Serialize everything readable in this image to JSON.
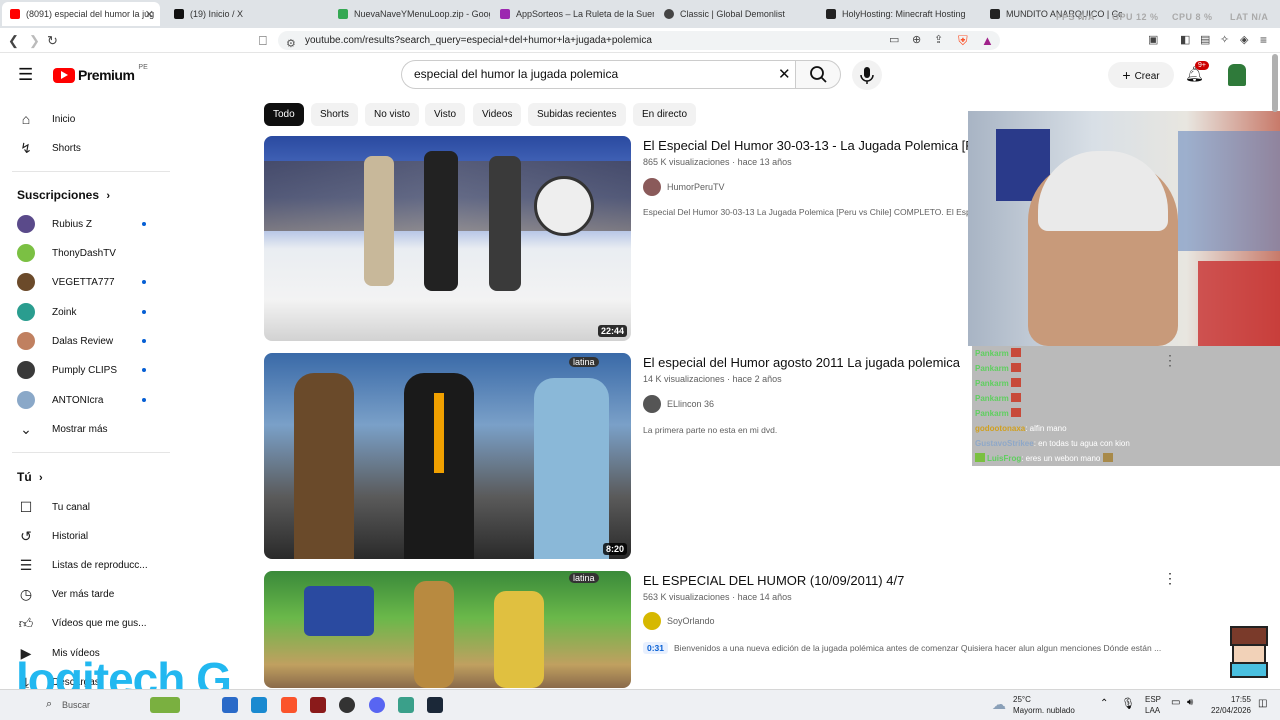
{
  "browser": {
    "tabs": [
      {
        "label": "(8091) especial del humor la jug",
        "fav": "#ff0000",
        "active": true
      },
      {
        "label": "(19) Inicio / X",
        "fav": "#111111"
      },
      {
        "label": "NuevaNaveYMenuLoop.zip - Googl",
        "fav": "#34a853"
      },
      {
        "label": "AppSorteos – La Ruleta de la Suerte",
        "fav": "#9c27b0"
      },
      {
        "label": "Classic | Global Demonlist",
        "fav": "#444444"
      },
      {
        "label": "HolyHosting: Minecraft Hosting",
        "fav": "#222222"
      },
      {
        "label": "MUNDITO ANARQUICO | Console",
        "fav": "#222222"
      }
    ],
    "url": "youtube.com/results?search_query=especial+del+humor+la+jugada+polemica",
    "stats": [
      "FPS N/A",
      "GPU 12 %",
      "CPU 8 %",
      "LAT N/A"
    ]
  },
  "yt": {
    "logo": "Premium",
    "region": "PE",
    "search_value": "especial del humor la jugada polemica",
    "create_label": "Crear",
    "notif_count": "9+",
    "chips": [
      "Todo",
      "Shorts",
      "No visto",
      "Visto",
      "Videos",
      "Subidas recientes",
      "En directo"
    ]
  },
  "sidebar": {
    "main": [
      {
        "label": "Inicio",
        "icon": "home-icon"
      },
      {
        "label": "Shorts",
        "icon": "shorts-icon"
      }
    ],
    "subs_header": "Suscripciones",
    "subs": [
      {
        "label": "Rubius Z",
        "color": "#5a4a8a",
        "dot": true
      },
      {
        "label": "ThonyDashTV",
        "color": "#7bc043",
        "dot": false
      },
      {
        "label": "VEGETTA777",
        "color": "#6b4a2a",
        "dot": true
      },
      {
        "label": "Zoink",
        "color": "#2a9d8f",
        "dot": true
      },
      {
        "label": "Dalas Review",
        "color": "#c08060",
        "dot": true
      },
      {
        "label": "Pumply CLIPS",
        "color": "#3a3a3a",
        "dot": true
      },
      {
        "label": "ANTONIcra",
        "color": "#8aa8c8",
        "dot": true
      }
    ],
    "more_label": "Mostrar más",
    "you_header": "Tú",
    "you": [
      {
        "label": "Tu canal",
        "icon": "channel-icon"
      },
      {
        "label": "Historial",
        "icon": "history-icon"
      },
      {
        "label": "Listas de reproducc...",
        "icon": "playlist-icon"
      },
      {
        "label": "Ver más tarde",
        "icon": "clock-icon"
      },
      {
        "label": "Vídeos que me gus...",
        "icon": "like-icon"
      },
      {
        "label": "Mis vídeos",
        "icon": "my-videos-icon"
      },
      {
        "label": "Descargas",
        "icon": "download-icon"
      }
    ]
  },
  "videos": [
    {
      "title": "El Especial Del Humor 30-03-13 - La Jugada Polemica [P",
      "views": "865 K visualizaciones",
      "age": "hace 13 años",
      "channel": "HumorPeruTV",
      "desc": "Especial Del Humor 30-03-13 La Jugada Polemica [Peru vs Chile] COMPLETO. El Esp",
      "duration": "22:44",
      "ch_color": "#8a5a5a"
    },
    {
      "title": "El especial del Humor agosto 2011 La jugada polemica",
      "views": "14 K visualizaciones",
      "age": "hace 2 años",
      "channel": "ELlincon 36",
      "desc": "La primera parte no esta en mi dvd.",
      "duration": "8:20",
      "ch_color": "#555555"
    },
    {
      "title": "EL ESPECIAL DEL HUMOR (10/09/2011) 4/7",
      "views": "563 K visualizaciones",
      "age": "hace 14 años",
      "channel": "SoyOrlando",
      "timestamp": "0:31",
      "desc": "Bienvenidos a una nueva edición de la jugada polémica antes de comenzar Quisiera hacer alun algun menciones Dónde están ...",
      "ch_color": "#d6b800"
    }
  ],
  "chat": [
    {
      "user": "Pankarm",
      "msg": ""
    },
    {
      "user": "Pankarm",
      "msg": ""
    },
    {
      "user": "Pankarm",
      "msg": ""
    },
    {
      "user": "Pankarm",
      "msg": ""
    },
    {
      "user": "Pankarm",
      "msg": ""
    },
    {
      "user": "godootonaxa",
      "msg": ": alfin mano"
    },
    {
      "user": "GustavoStrikee",
      "msg": ": en todas tu agua con kion"
    },
    {
      "user": "LuisFrog",
      "msg": ": eres un webon mano"
    }
  ],
  "overlay": {
    "logo": "logitech G"
  },
  "taskbar": {
    "search_placeholder": "Buscar",
    "temp": "25°C",
    "weather": "Mayorm. nublado",
    "lang": "ESP",
    "lang2": "LAA",
    "time": "17:55",
    "date": "22/04/2026"
  }
}
